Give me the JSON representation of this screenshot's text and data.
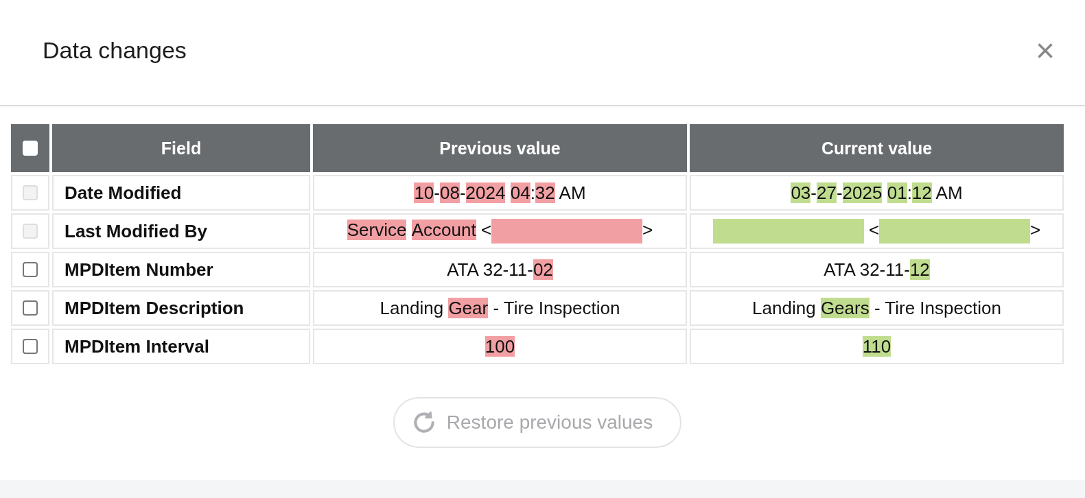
{
  "dialog": {
    "title": "Data changes",
    "close": "×"
  },
  "table": {
    "select_all": {
      "checked": false
    },
    "columns": [
      "Field",
      "Previous value",
      "Current value"
    ],
    "rows": [
      {
        "checked": false,
        "disabled": true,
        "field": "Date Modified",
        "previous": [
          {
            "kind": "text",
            "text": "10",
            "changed": true
          },
          {
            "kind": "text",
            "text": "-",
            "changed": false
          },
          {
            "kind": "text",
            "text": "08",
            "changed": true
          },
          {
            "kind": "text",
            "text": "-",
            "changed": false
          },
          {
            "kind": "text",
            "text": "2024",
            "changed": true,
            "space_after": true
          },
          {
            "kind": "text",
            "text": "04",
            "changed": true
          },
          {
            "kind": "text",
            "text": ":",
            "changed": false
          },
          {
            "kind": "text",
            "text": "32",
            "changed": true
          },
          {
            "kind": "text",
            "text": " AM",
            "changed": false
          }
        ],
        "current": [
          {
            "kind": "text",
            "text": "03",
            "changed": true
          },
          {
            "kind": "text",
            "text": "-",
            "changed": false
          },
          {
            "kind": "text",
            "text": "27",
            "changed": true
          },
          {
            "kind": "text",
            "text": "-",
            "changed": false
          },
          {
            "kind": "text",
            "text": "2025",
            "changed": true,
            "space_after": true
          },
          {
            "kind": "text",
            "text": "01",
            "changed": true
          },
          {
            "kind": "text",
            "text": ":",
            "changed": false
          },
          {
            "kind": "text",
            "text": "12",
            "changed": true
          },
          {
            "kind": "text",
            "text": " AM",
            "changed": false
          }
        ]
      },
      {
        "checked": false,
        "disabled": true,
        "field": "Last Modified By",
        "previous": [
          {
            "kind": "text",
            "text": "Service",
            "changed": true,
            "space_after": true
          },
          {
            "kind": "text",
            "text": "Account",
            "changed": true
          },
          {
            "kind": "text",
            "text": " <",
            "changed": false
          },
          {
            "kind": "redacted",
            "changed": true
          },
          {
            "kind": "text",
            "text": ">",
            "changed": false
          }
        ],
        "current": [
          {
            "kind": "redacted",
            "changed": true
          },
          {
            "kind": "text",
            "text": " <",
            "changed": false
          },
          {
            "kind": "redacted",
            "changed": true
          },
          {
            "kind": "text",
            "text": ">",
            "changed": false
          }
        ]
      },
      {
        "checked": false,
        "disabled": false,
        "field": "MPDItem Number",
        "previous": [
          {
            "kind": "text",
            "text": "ATA 32-11-",
            "changed": false
          },
          {
            "kind": "text",
            "text": "02",
            "changed": true
          }
        ],
        "current": [
          {
            "kind": "text",
            "text": "ATA 32-11-",
            "changed": false
          },
          {
            "kind": "text",
            "text": "12",
            "changed": true
          }
        ]
      },
      {
        "checked": false,
        "disabled": false,
        "field": "MPDItem Description",
        "previous": [
          {
            "kind": "text",
            "text": "Landing ",
            "changed": false
          },
          {
            "kind": "text",
            "text": "Gear",
            "changed": true
          },
          {
            "kind": "text",
            "text": " - Tire Inspection",
            "changed": false
          }
        ],
        "current": [
          {
            "kind": "text",
            "text": "Landing ",
            "changed": false
          },
          {
            "kind": "text",
            "text": "Gears",
            "changed": true
          },
          {
            "kind": "text",
            "text": " - Tire Inspection",
            "changed": false
          }
        ]
      },
      {
        "checked": false,
        "disabled": false,
        "field": "MPDItem Interval",
        "previous": [
          {
            "kind": "text",
            "text": "100",
            "changed": true
          }
        ],
        "current": [
          {
            "kind": "text",
            "text": "110",
            "changed": true
          }
        ]
      }
    ]
  },
  "restore_button": {
    "label": "Restore previous values",
    "disabled": true
  }
}
